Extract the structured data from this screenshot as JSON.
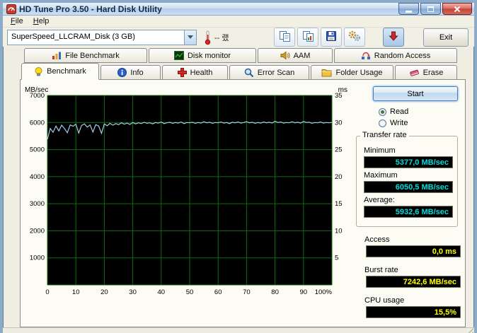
{
  "window": {
    "title": "HD Tune Pro 3.50 - Hard Disk Utility",
    "controls": [
      "minimize",
      "maximize",
      "close"
    ]
  },
  "menu": {
    "items": [
      {
        "label": "File"
      },
      {
        "label": "Help"
      }
    ]
  },
  "toolbar": {
    "drive_select_value": "SuperSpeed_LLCRAM_Disk (3 GB)",
    "temperature_text": "-- 랬",
    "exit_label": "Exit",
    "icons": [
      "thermometer-icon",
      "copy-icon",
      "copy-image-icon",
      "save-icon",
      "options-icon",
      "down-arrow-icon"
    ]
  },
  "tabs": {
    "upper": [
      {
        "label": "File Benchmark",
        "icon": "file-benchmark-icon"
      },
      {
        "label": "Disk monitor",
        "icon": "disk-monitor-icon"
      },
      {
        "label": "AAM",
        "icon": "aam-icon"
      },
      {
        "label": "Random Access",
        "icon": "random-access-icon"
      }
    ],
    "lower": [
      {
        "label": "Benchmark",
        "icon": "benchmark-icon",
        "active": true
      },
      {
        "label": "Info",
        "icon": "info-icon",
        "active": false
      },
      {
        "label": "Health",
        "icon": "health-icon",
        "active": false
      },
      {
        "label": "Error Scan",
        "icon": "error-scan-icon",
        "active": false
      },
      {
        "label": "Folder Usage",
        "icon": "folder-usage-icon",
        "active": false
      },
      {
        "label": "Erase",
        "icon": "erase-icon",
        "active": false
      }
    ]
  },
  "panel": {
    "start_label": "Start",
    "read_label": "Read",
    "write_label": "Write",
    "read_selected": true,
    "transfer_rate": {
      "group_label": "Transfer rate",
      "minimum_label": "Minimum",
      "minimum_value": "5377,0 MB/sec",
      "maximum_label": "Maximum",
      "maximum_value": "6050,5 MB/sec",
      "average_label": "Average:",
      "average_value": "5932,6 MB/sec",
      "value_color": "#00dcdc"
    },
    "access": {
      "label": "Access",
      "value": "0,0 ms",
      "color": "#ffff00"
    },
    "burst": {
      "label": "Burst rate",
      "value": "7242,6 MB/sec",
      "color": "#ffff00"
    },
    "cpu": {
      "label": "CPU usage",
      "value": "15,5%",
      "color": "#ffff00"
    }
  },
  "status": {
    "text": ""
  },
  "chart_data": {
    "type": "line",
    "title": "",
    "ylabel_left": "MB/sec",
    "ylabel_right": "ms",
    "y_left_range": [
      0,
      7000
    ],
    "y_left_ticks": [
      1000,
      2000,
      3000,
      4000,
      5000,
      6000,
      7000
    ],
    "y_right_range": [
      0,
      35
    ],
    "y_right_ticks": [
      5,
      10,
      15,
      20,
      25,
      30,
      35
    ],
    "x_range": [
      0,
      100
    ],
    "x_ticks": [
      "0",
      "10",
      "20",
      "30",
      "40",
      "50",
      "60",
      "70",
      "80",
      "90",
      "100%"
    ],
    "grid": true,
    "legend": "none",
    "plot_bg": "#000000",
    "grid_color": "#0b6e0b",
    "line_color": "#a4cde9",
    "series": [
      {
        "name": "Read transfer rate (MB/sec)",
        "x_step_percent": 1,
        "values": [
          5380,
          5780,
          5640,
          5870,
          5690,
          5900,
          5780,
          5620,
          5910,
          5860,
          5940,
          5610,
          5890,
          5950,
          5830,
          5910,
          5650,
          5920,
          5870,
          5600,
          5950,
          5880,
          5970,
          5900,
          5960,
          5920,
          5990,
          5940,
          5980,
          5930,
          6000,
          5950,
          5990,
          5960,
          6010,
          5970,
          5990,
          5950,
          6000,
          5980,
          6020,
          5960,
          5990,
          6010,
          5970,
          6000,
          5980,
          6020,
          5960,
          6000,
          5990,
          6010,
          5970,
          6000,
          5980,
          6030,
          5990,
          6010,
          5970,
          6000,
          5990,
          6020,
          5980,
          6000,
          5960,
          6010,
          5990,
          6020,
          5980,
          6000,
          6030,
          5990,
          6010,
          5970,
          6000,
          5980,
          6020,
          5990,
          6010,
          5980,
          6050,
          6000,
          6020,
          5980,
          6000,
          5990,
          6030,
          5990,
          6010,
          5980,
          6040,
          6000,
          6010,
          5970,
          6000,
          5990,
          6020,
          5980,
          6000,
          5990,
          6000
        ]
      }
    ]
  }
}
